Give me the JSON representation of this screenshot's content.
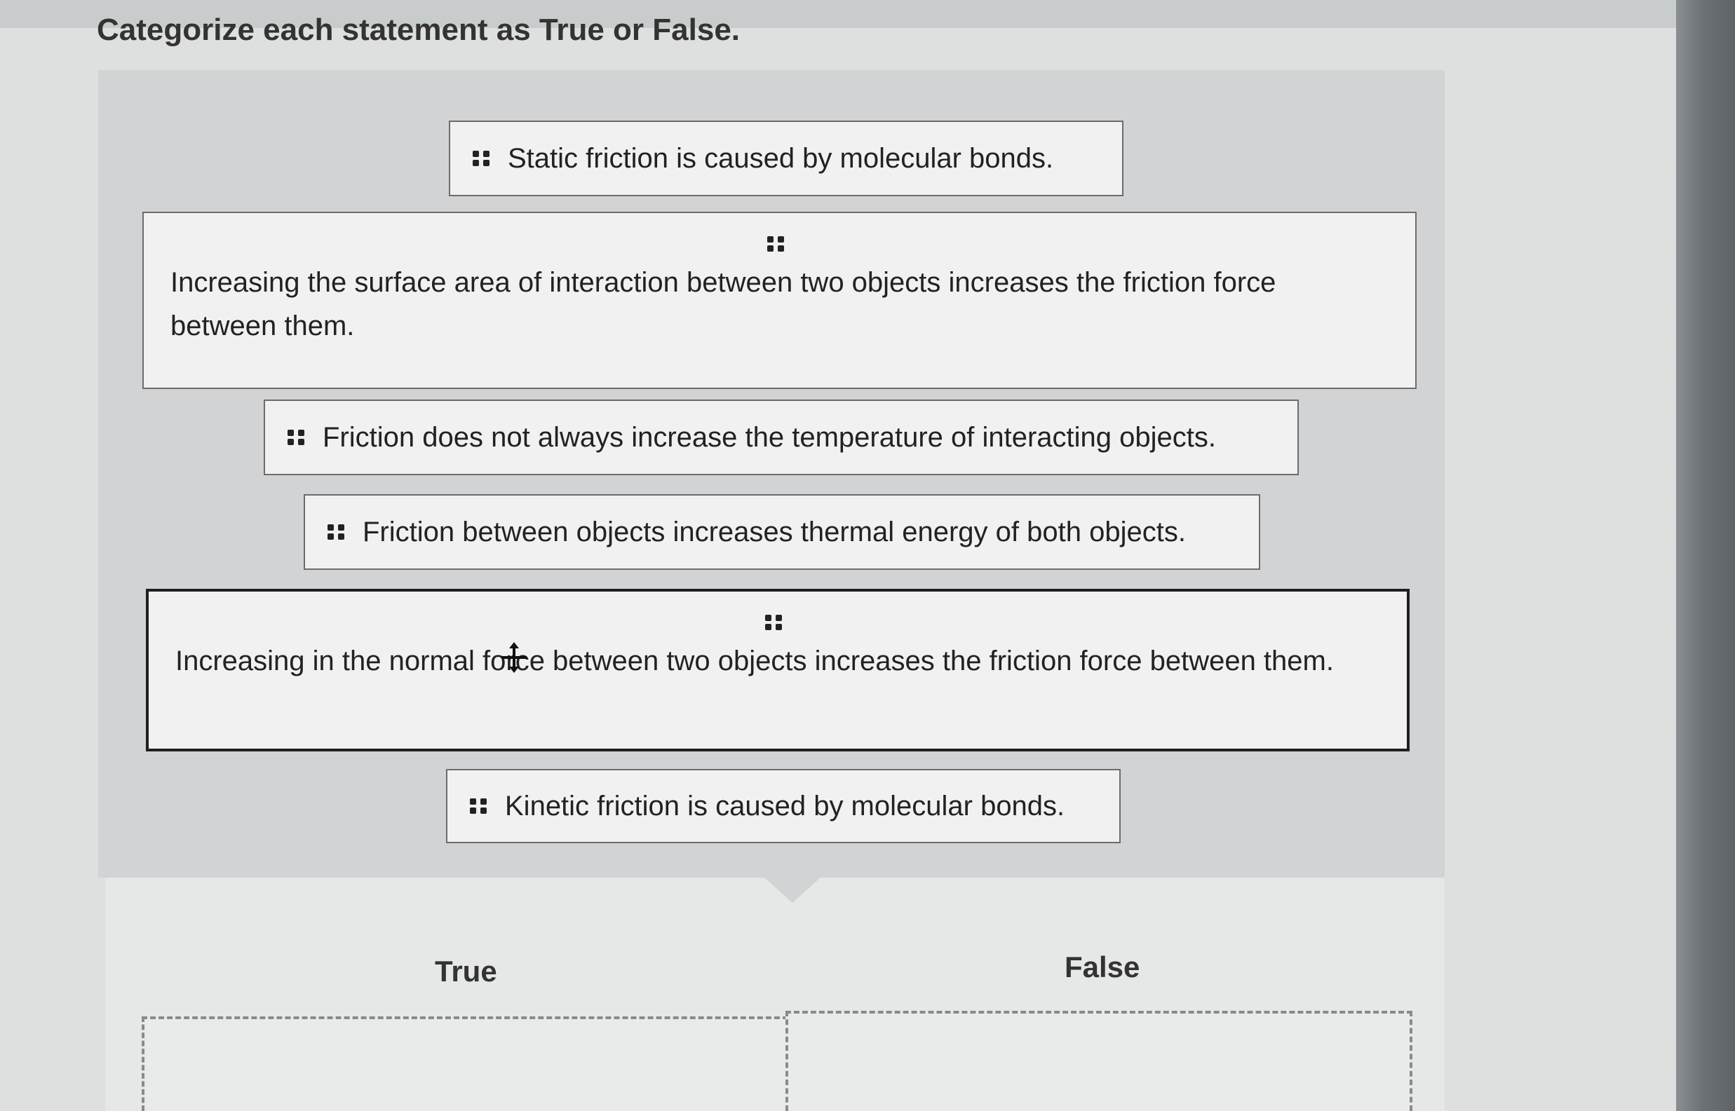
{
  "prompt": "Categorize each statement as True or False.",
  "statements": [
    "Static friction is caused by molecular bonds.",
    "Increasing the surface area of interaction between two objects increases the friction force between them.",
    "Friction does not always increase the temperature of interacting objects.",
    "Friction between objects increases thermal energy of both objects.",
    "Increasing in the normal force between two objects increases the friction force between them.",
    "Kinetic friction is caused by molecular bonds."
  ],
  "categories": {
    "true_label": "True",
    "false_label": "False"
  },
  "icons": {
    "drag_handle": "drag-handle-icon",
    "cursor": "move-cursor-icon"
  },
  "colors": {
    "card_bg": "#f1f1f1",
    "card_border": "#6c6c6c",
    "pool_bg": "#d2d3d4"
  }
}
